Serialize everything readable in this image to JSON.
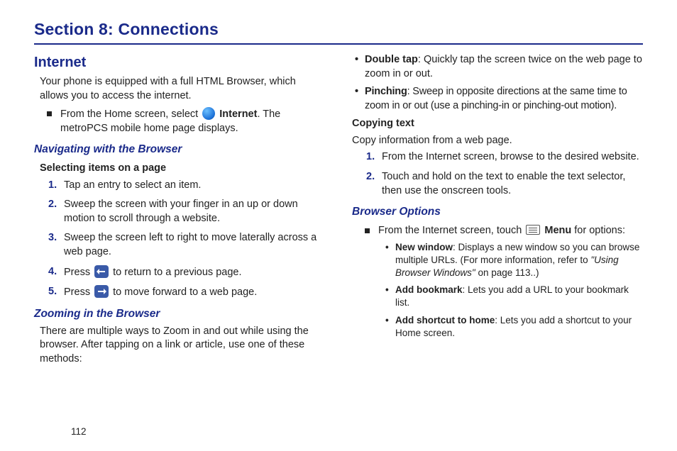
{
  "section_title": "Section 8: Connections",
  "page_number": "112",
  "left": {
    "internet_heading": "Internet",
    "intro": "Your phone is equipped with a full HTML Browser, which allows you to access the internet.",
    "home_step_pre": "From the Home screen, select ",
    "home_step_bold": " Internet",
    "home_step_post": ". The metroPCS mobile home page displays.",
    "nav_heading": "Navigating with the Browser",
    "selecting_heading": "Selecting items on a page",
    "steps": {
      "s1": "Tap an entry to select an item.",
      "s2": "Sweep the screen with your finger in an up or down motion to scroll through a website.",
      "s3": "Sweep the screen left to right to move laterally across a web page.",
      "s4a": "Press ",
      "s4b": " to return to a previous page.",
      "s5a": "Press ",
      "s5b": " to move forward to a web page."
    },
    "zoom_heading": "Zooming in the Browser",
    "zoom_intro": "There are multiple ways to Zoom in and out while using the browser. After tapping on a link or article, use one of these methods:"
  },
  "right": {
    "dtap_bold": "Double tap",
    "dtap_text": ": Quickly tap the screen twice on the web page to zoom in or out.",
    "pinch_bold": "Pinching",
    "pinch_text": ": Sweep in opposite directions at the same time to zoom in or out (use a pinching-in or pinching-out motion).",
    "copy_heading": "Copying text",
    "copy_intro": "Copy information from a web page.",
    "copy_steps": {
      "c1": "From the Internet screen, browse to the desired website.",
      "c2": "Touch and hold on the text to enable the text selector, then use the onscreen tools."
    },
    "browser_options_heading": "Browser Options",
    "menu_pre": "From the Internet screen, touch ",
    "menu_bold": " Menu",
    "menu_post": " for options:",
    "opts": {
      "nw_bold": "New window",
      "nw_text": ": Displays a new window so you can browse multiple URLs. (For more information, refer to ",
      "nw_ref": "\"Using Browser Windows\"",
      "nw_tail": "  on page 113..)",
      "ab_bold": "Add bookmark",
      "ab_text": ": Lets you add a URL to your bookmark list.",
      "as_bold": "Add shortcut to home",
      "as_text": ": Lets you add a shortcut to your Home screen."
    }
  }
}
